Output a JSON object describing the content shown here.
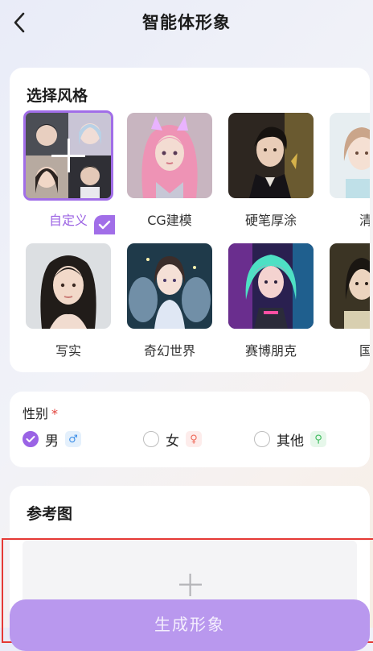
{
  "header": {
    "title": "智能体形象"
  },
  "style_section": {
    "title": "选择风格",
    "items": [
      {
        "label": "自定义",
        "selected": true
      },
      {
        "label": "CG建模",
        "selected": false
      },
      {
        "label": "硬笔厚涂",
        "selected": false
      },
      {
        "label": "清新",
        "selected": false
      },
      {
        "label": "写实",
        "selected": false
      },
      {
        "label": "奇幻世界",
        "selected": false
      },
      {
        "label": "赛博朋克",
        "selected": false
      },
      {
        "label": "国风",
        "selected": false
      }
    ]
  },
  "gender": {
    "label": "性别",
    "required_mark": "*",
    "options": [
      {
        "label": "男",
        "checked": true,
        "icon": "male-icon",
        "icon_glyph": "♂",
        "color": "#3d8fe8"
      },
      {
        "label": "女",
        "checked": false,
        "icon": "female-icon",
        "icon_glyph": "♀",
        "color": "#ef6a5a"
      },
      {
        "label": "其他",
        "checked": false,
        "icon": "other-gender-icon",
        "icon_glyph": "⚲",
        "color": "#3dbb5c"
      }
    ]
  },
  "reference": {
    "title": "参考图"
  },
  "generate_button": {
    "label": "生成形象"
  },
  "colors": {
    "accent": "#9a63e5",
    "button": "#b998ee",
    "required": "#e2413a"
  }
}
